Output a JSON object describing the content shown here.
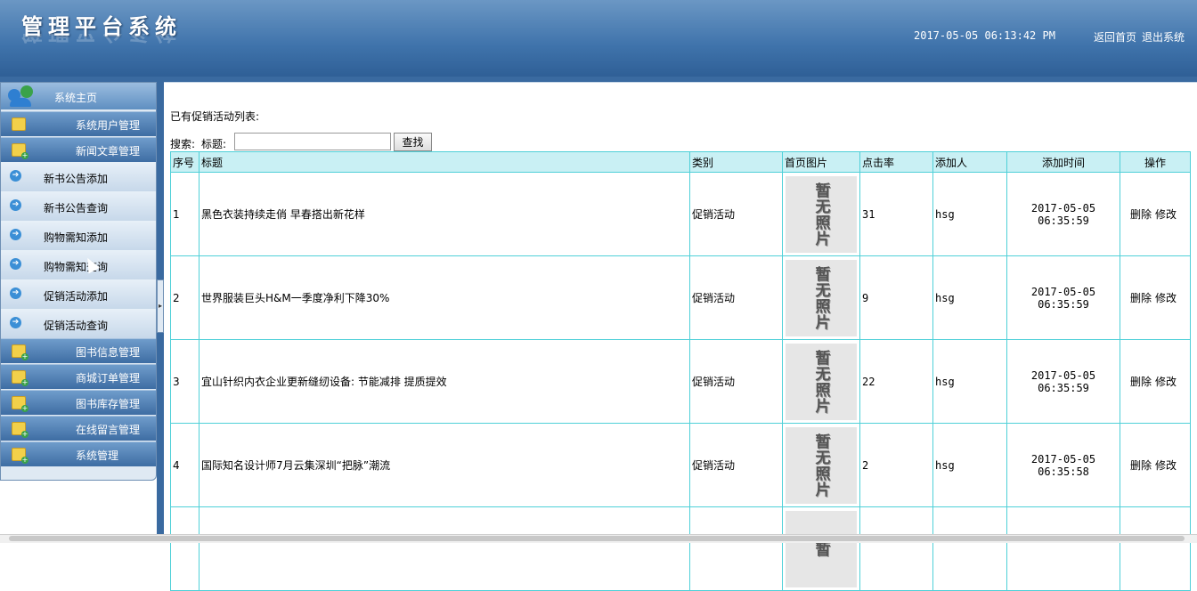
{
  "header": {
    "title": "管理平台系统",
    "datetime": "2017-05-05 06:13:42 PM",
    "link_home": "返回首页",
    "link_logout": "退出系统"
  },
  "sidebar": {
    "home_label": "系统主页",
    "groups_top": [
      {
        "label": "系统用户管理",
        "icon": "folder-icon"
      },
      {
        "label": "新闻文章管理",
        "icon": "folder-add-icon"
      }
    ],
    "sub_items": [
      {
        "label": "新书公告添加"
      },
      {
        "label": "新书公告查询"
      },
      {
        "label": "购物需知添加"
      },
      {
        "label": "购物需知查询"
      },
      {
        "label": "促销活动添加"
      },
      {
        "label": "促销活动查询"
      }
    ],
    "groups_bottom": [
      {
        "label": "图书信息管理"
      },
      {
        "label": "商城订单管理"
      },
      {
        "label": "图书库存管理"
      },
      {
        "label": "在线留言管理"
      },
      {
        "label": "系统管理"
      }
    ]
  },
  "main": {
    "caption": "已有促销活动列表:",
    "search_label": "搜索:",
    "title_label": "标题:",
    "search_value": "",
    "search_button": "查找",
    "columns": [
      "序号",
      "标题",
      "类别",
      "首页图片",
      "点击率",
      "添加人",
      "添加时间",
      "操作"
    ],
    "no_photo_text": "暂无照片",
    "delete_label": "删除",
    "edit_label": "修改",
    "rows": [
      {
        "no": "1",
        "title": "黑色衣装持续走俏 早春搭出新花样",
        "category": "促销活动",
        "clicks": "31",
        "author": "hsg",
        "time": "2017-05-05 06:35:59"
      },
      {
        "no": "2",
        "title": "世界服装巨头H&M一季度净利下降30%",
        "category": "促销活动",
        "clicks": "9",
        "author": "hsg",
        "time": "2017-05-05 06:35:59"
      },
      {
        "no": "3",
        "title": "宜山针织内衣企业更新缝纫设备: 节能减排 提质提效",
        "category": "促销活动",
        "clicks": "22",
        "author": "hsg",
        "time": "2017-05-05 06:35:59"
      },
      {
        "no": "4",
        "title": "国际知名设计师7月云集深圳“把脉”潮流",
        "category": "促销活动",
        "clicks": "2",
        "author": "hsg",
        "time": "2017-05-05 06:35:58"
      }
    ],
    "partial_row_photo_text": "暂"
  },
  "colors": {
    "header_blue": "#3f73ab",
    "table_border": "#4fd0d8",
    "table_header_bg": "#c9f0f4"
  }
}
